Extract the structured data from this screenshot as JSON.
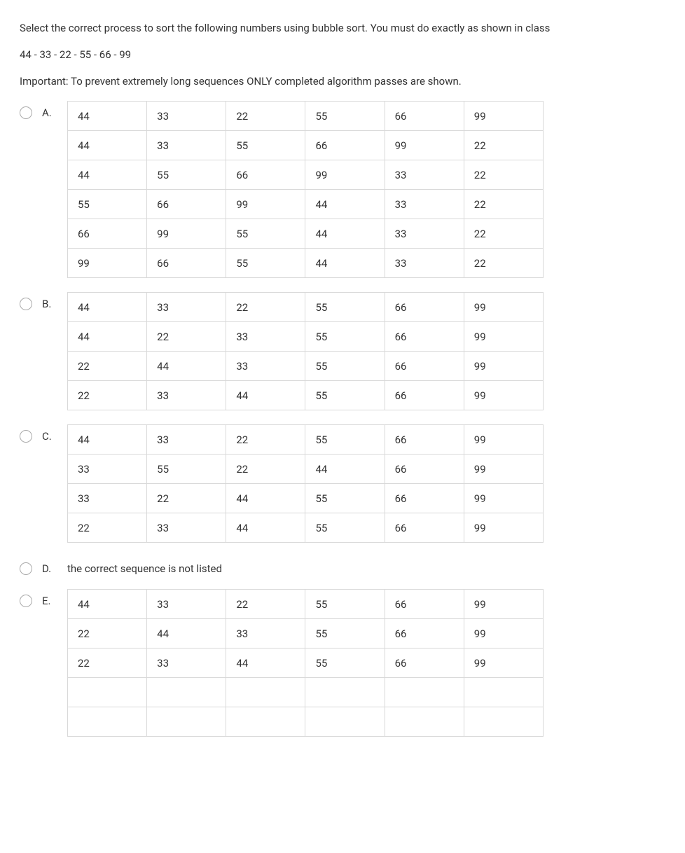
{
  "question": {
    "line1": "Select the correct process to sort the following numbers using bubble sort. You must do exactly as shown in class",
    "line2": "44 - 33 - 22 - 55 - 66 - 99",
    "line3": "Important: To prevent extremely long sequences ONLY completed algorithm passes are shown."
  },
  "options": [
    {
      "letter": "A.",
      "type": "table",
      "rows": [
        [
          "44",
          "33",
          "22",
          "55",
          "66",
          "99"
        ],
        [
          "44",
          "33",
          "55",
          "66",
          "99",
          "22"
        ],
        [
          "44",
          "55",
          "66",
          "99",
          "33",
          "22"
        ],
        [
          "55",
          "66",
          "99",
          "44",
          "33",
          "22"
        ],
        [
          "66",
          "99",
          "55",
          "44",
          "33",
          "22"
        ],
        [
          "99",
          "66",
          "55",
          "44",
          "33",
          "22"
        ]
      ]
    },
    {
      "letter": "B.",
      "type": "table",
      "rows": [
        [
          "44",
          "33",
          "22",
          "55",
          "66",
          "99"
        ],
        [
          "44",
          "22",
          "33",
          "55",
          "66",
          "99"
        ],
        [
          "22",
          "44",
          "33",
          "55",
          "66",
          "99"
        ],
        [
          "22",
          "33",
          "44",
          "55",
          "66",
          "99"
        ]
      ]
    },
    {
      "letter": "C.",
      "type": "table",
      "rows": [
        [
          "44",
          "33",
          "22",
          "55",
          "66",
          "99"
        ],
        [
          "33",
          "55",
          "22",
          "44",
          "66",
          "99"
        ],
        [
          "33",
          "22",
          "44",
          "55",
          "66",
          "99"
        ],
        [
          "22",
          "33",
          "44",
          "55",
          "66",
          "99"
        ]
      ]
    },
    {
      "letter": "D.",
      "type": "text",
      "text": "the correct sequence is not listed"
    },
    {
      "letter": "E.",
      "type": "table",
      "rows": [
        [
          "44",
          "33",
          "22",
          "55",
          "66",
          "99"
        ],
        [
          "22",
          "44",
          "33",
          "55",
          "66",
          "99"
        ],
        [
          "22",
          "33",
          "44",
          "55",
          "66",
          "99"
        ],
        [
          "",
          "",
          "",
          "",
          "",
          ""
        ],
        [
          "",
          "",
          "",
          "",
          "",
          ""
        ]
      ]
    }
  ]
}
